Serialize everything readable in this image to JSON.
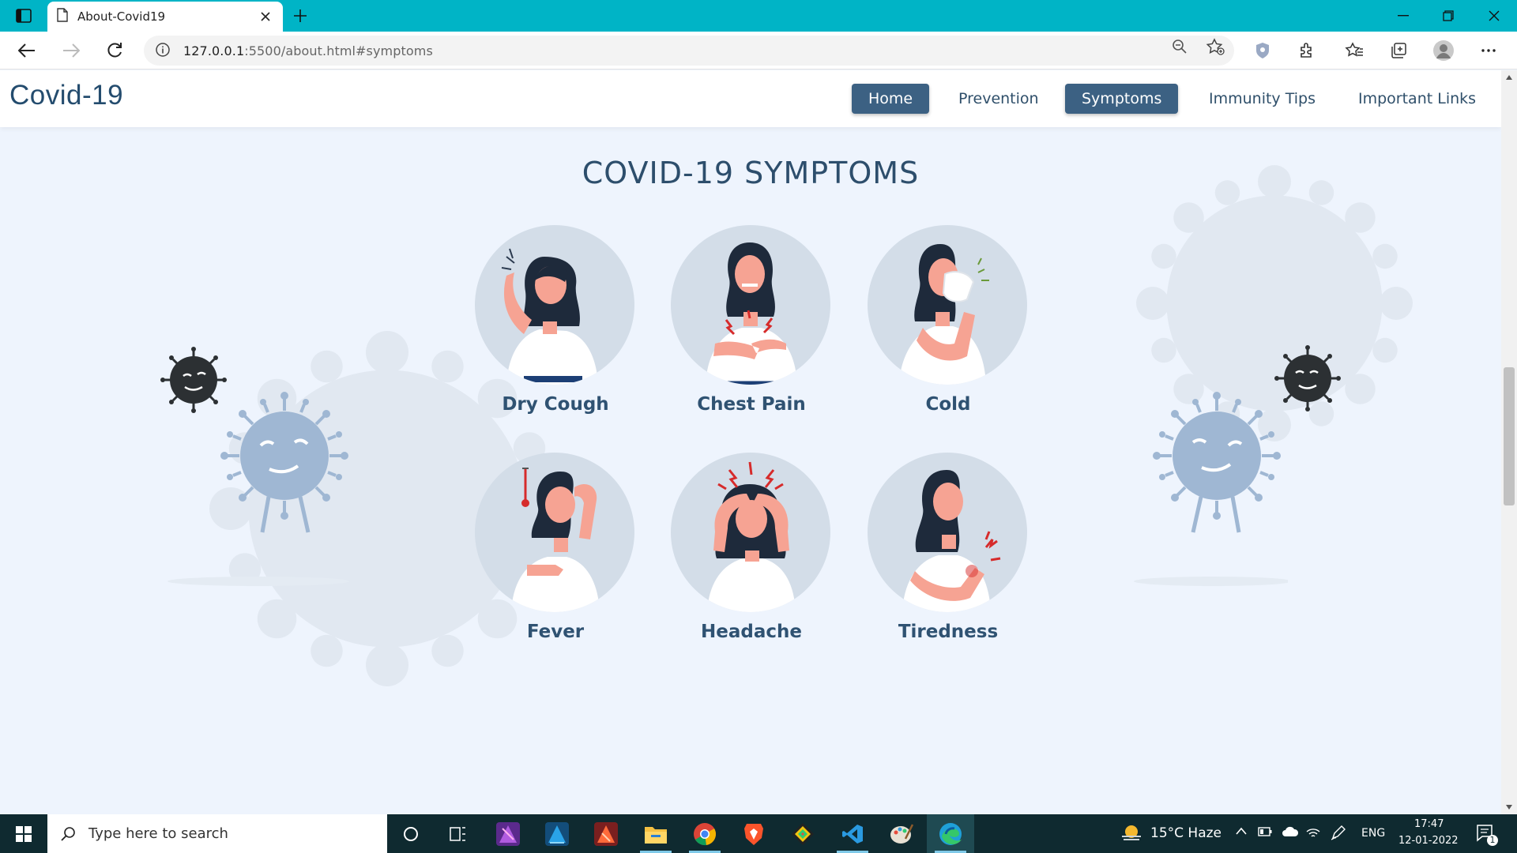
{
  "browser": {
    "tab_title": "About-Covid19",
    "url_host": "127.0.0.1",
    "url_rest": ":5500/about.html#symptoms"
  },
  "site": {
    "logo": "Covid-19",
    "nav": [
      {
        "label": "Home",
        "active": true
      },
      {
        "label": "Prevention",
        "active": false
      },
      {
        "label": "Symptoms",
        "active": true
      },
      {
        "label": "Immunity Tips",
        "active": false
      },
      {
        "label": "Important Links",
        "active": false
      }
    ],
    "section_title": "COVID-19 SYMPTOMS",
    "symptoms": [
      {
        "label": "Dry Cough"
      },
      {
        "label": "Chest Pain"
      },
      {
        "label": "Cold"
      },
      {
        "label": "Fever"
      },
      {
        "label": "Headache"
      },
      {
        "label": "Tiredness"
      }
    ]
  },
  "taskbar": {
    "search_placeholder": "Type here to search",
    "weather": "15°C  Haze",
    "language": "ENG",
    "time": "17:47",
    "date": "12-01-2022",
    "notification_count": "1"
  },
  "colors": {
    "titlebar": "#00b4c6",
    "brand": "#244c6e",
    "nav_active": "#3c6183",
    "page_bg": "#eef4fd",
    "virus_blue": "#9fb7d3",
    "virus_dark": "#2c3033"
  }
}
